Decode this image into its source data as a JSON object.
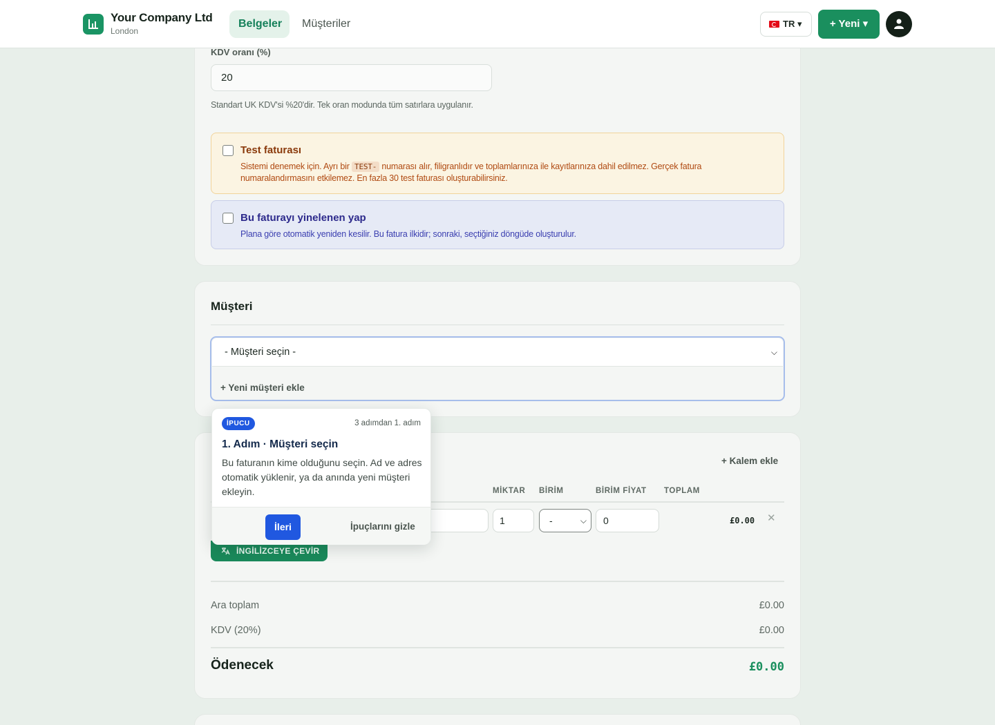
{
  "header": {
    "company_name": "Your Company Ltd",
    "company_city": "London",
    "tabs": [
      {
        "label": "Belgeler",
        "active": true
      },
      {
        "label": "Müşteriler",
        "active": false
      }
    ],
    "language_label": "TR ▾",
    "new_button_label": "+ Yeni ▾",
    "brand_color": "#1a8f5e"
  },
  "tax": {
    "label": "KDV oranı (%)",
    "value": "20",
    "help": "Standart UK KDV'si %20'dir. Tek oran modunda tüm satırlara uygulanır."
  },
  "test_invoice": {
    "title": "Test faturası",
    "desc_before": "Sistemi denemek için. Ayrı bir",
    "code": "TEST-",
    "desc_after": "numarası alır, filigranlıdır ve toplamlarınıza ile kayıtlarınıza dahil edilmez. Gerçek fatura numaralandırmasını etkilemez. En fazla 30 test faturası oluşturabilirsiniz.",
    "checked": false
  },
  "recurring": {
    "title": "Bu faturayı yinelenen yap",
    "desc": "Plana göre otomatik yeniden kesilir. Bu fatura ilkidir; sonraki, seçtiğiniz döngüde oluşturulur.",
    "checked": false
  },
  "customer": {
    "section_title": "Müşteri",
    "select_value": "- Müşteri seçin -",
    "add_new": "+ Yeni müşteri ekle"
  },
  "items": {
    "add_item": "+ Kalem ekle",
    "columns": [
      "MİKTAR",
      "BİRİM",
      "BİRİM FİYAT",
      "TOPLAM"
    ],
    "rows": [
      {
        "qty": "1",
        "unit": "-",
        "price": "0",
        "total": "£0.00"
      }
    ],
    "translate_button": "İNGİLİZCEYE ÇEVİR"
  },
  "totals": {
    "subtotal_label": "Ara toplam",
    "subtotal_value": "£0.00",
    "vat_label": "KDV (20%)",
    "vat_value": "£0.00",
    "due_label": "Ödenecek",
    "due_value": "£0.00"
  },
  "tip": {
    "badge": "İPUCU",
    "step": "3 adımdan 1. adım",
    "title": "1. Adım · Müşteri seçin",
    "body": "Bu faturanın kime olduğunu seçin. Ad ve adres otomatik yüklenir, ya da anında yeni müşteri ekleyin.",
    "next": "İleri",
    "hide": "İpuçlarını gizle"
  }
}
